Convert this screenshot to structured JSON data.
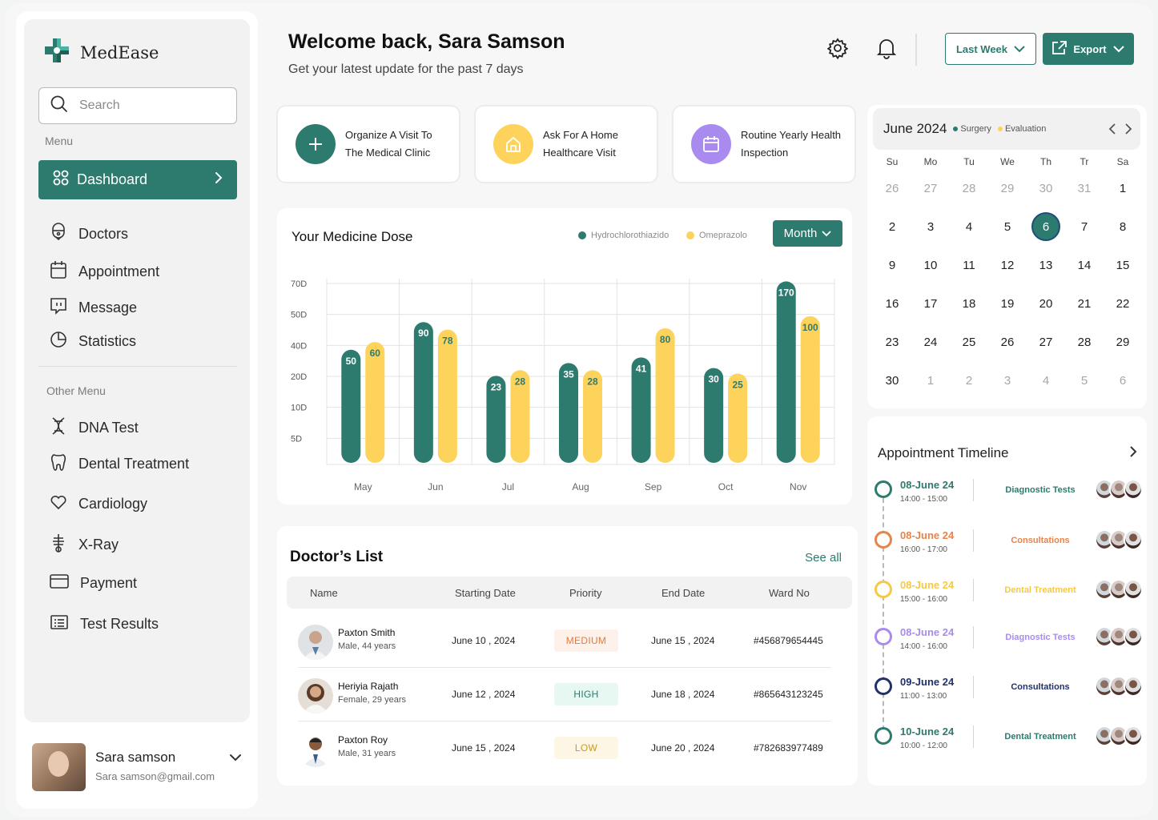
{
  "app": {
    "name": "MedEase"
  },
  "search": {
    "placeholder": "Search"
  },
  "sidebar": {
    "menu_caption": "Menu",
    "active_item": "Dashboard",
    "items": [
      "Doctors",
      "Appointment",
      "Message",
      "Statistics"
    ],
    "other_caption": "Other Menu",
    "other_items": [
      "DNA Test",
      "Dental Treatment",
      "Cardiology",
      "X-Ray",
      "Payment",
      "Test Results"
    ]
  },
  "user": {
    "name": "Sara samson",
    "email": "Sara samson@gmail.com"
  },
  "header": {
    "title": "Welcome back, Sara Samson",
    "subtitle": "Get your latest update for the past 7 days",
    "range_label": "Last Week",
    "export_label": "Export"
  },
  "actions": [
    {
      "label": "Organize A Visit To The Medical Clinic",
      "icon": "plus-icon",
      "color": "#2d7a6f"
    },
    {
      "label": "Ask For A Home Healthcare Visit",
      "icon": "home-icon",
      "color": "#fdd35c"
    },
    {
      "label": "Routine Yearly Health Inspection",
      "icon": "calendar-icon",
      "color": "#a98bf0"
    }
  ],
  "chart": {
    "title": "Your Medicine Dose",
    "period_label": "Month"
  },
  "chart_data": {
    "type": "bar",
    "categories": [
      "May",
      "Jun",
      "Jul",
      "Aug",
      "Sep",
      "Oct",
      "Nov"
    ],
    "y_tick_labels": [
      "70D",
      "50D",
      "40D",
      "20D",
      "10D",
      "5D"
    ],
    "series": [
      {
        "name": "Hydrochlorothiazido",
        "color": "#2d7a6f",
        "values": [
          50,
          90,
          23,
          35,
          41,
          30,
          170
        ]
      },
      {
        "name": "Omeprazolo",
        "color": "#fdd35c",
        "values": [
          60,
          78,
          28,
          28,
          80,
          25,
          100
        ]
      }
    ],
    "grid": true,
    "legend": "top-right"
  },
  "calendar": {
    "month_label": "June 2024",
    "legend": [
      {
        "name": "Surgery",
        "color": "#2d7a6f"
      },
      {
        "name": "Evaluation",
        "color": "#fdd35c"
      }
    ],
    "weekdays": [
      "Su",
      "Mo",
      "Tu",
      "We",
      "Th",
      "Tr",
      "Sa"
    ],
    "weeks": [
      [
        "26",
        "27",
        "28",
        "29",
        "30",
        "31",
        "1"
      ],
      [
        "2",
        "3",
        "4",
        "5",
        "6",
        "7",
        "8"
      ],
      [
        "9",
        "10",
        "11",
        "12",
        "13",
        "14",
        "15"
      ],
      [
        "16",
        "17",
        "18",
        "19",
        "20",
        "21",
        "22"
      ],
      [
        "23",
        "24",
        "25",
        "26",
        "27",
        "28",
        "29"
      ],
      [
        "30",
        "1",
        "2",
        "3",
        "4",
        "5",
        "6"
      ]
    ],
    "selected_day": "6"
  },
  "doctors": {
    "title": "Doctor’s  List",
    "see_all": "See all",
    "columns": [
      "Name",
      "Starting Date",
      "Priority",
      "End Date",
      "Ward No"
    ],
    "rows": [
      {
        "name": "Paxton Smith",
        "meta": "Male,  44 years",
        "start": "June 10 , 2024",
        "priority": "MEDIUM",
        "end": "June 15 , 2024",
        "ward": "#456879654445"
      },
      {
        "name": "Heriyia  Rajath",
        "meta": "Female,  29 years",
        "start": "June 12 , 2024",
        "priority": "HIGH",
        "end": "June 18 , 2024",
        "ward": "#865643123245"
      },
      {
        "name": "Paxton Roy",
        "meta": "Male,  31 years",
        "start": "June 15 , 2024",
        "priority": "LOW",
        "end": "June 20 , 2024",
        "ward": "#782683977489"
      }
    ]
  },
  "timeline": {
    "title": "Appointment Timeline",
    "items": [
      {
        "date": "08-June 24",
        "time": "14:00 - 15:00",
        "type": "Diagnostic Tests",
        "color": "#2d7a6f"
      },
      {
        "date": "08-June 24",
        "time": "16:00 - 17:00",
        "type": "Consultations",
        "color": "#e8834a"
      },
      {
        "date": "08-June 24",
        "time": "15:00 - 16:00",
        "type": "Dental Treatment",
        "color": "#f6c844"
      },
      {
        "date": "08-June 24",
        "time": "14:00 - 16:00",
        "type": "Diagnostic Tests",
        "color": "#a98bf0"
      },
      {
        "date": "09-June 24",
        "time": "11:00 - 13:00",
        "type": "Consultations",
        "color": "#22306b"
      },
      {
        "date": "10-June 24",
        "time": "10:00 - 12:00",
        "type": "Dental Treatment",
        "color": "#2d7a6f"
      }
    ]
  }
}
